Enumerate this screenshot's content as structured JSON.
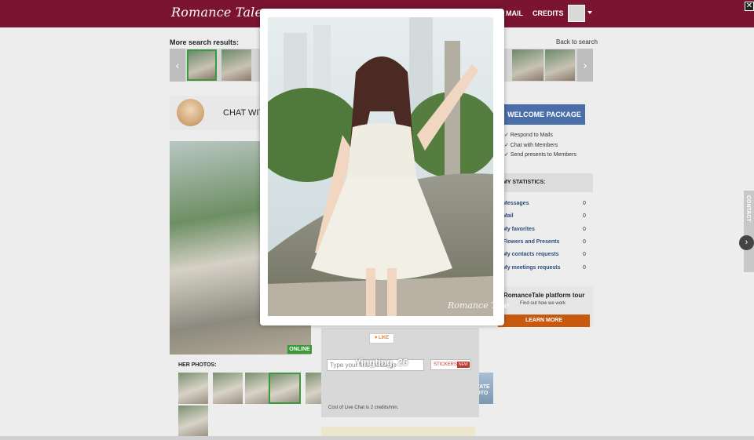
{
  "header": {
    "logo": "Romance Tale",
    "nav": [
      {
        "label": "MAIL"
      },
      {
        "label": "CREDITS"
      }
    ],
    "close": "✕"
  },
  "search": {
    "title": "More search results:",
    "back": "Back to search"
  },
  "profile": {
    "chat_with": "CHAT WIT",
    "online": "ONLINE",
    "her_photos": "HER PHOTOS:",
    "private_photo": "PRIVATE PHOTO"
  },
  "chat": {
    "like": "LIKE",
    "input_placeholder": "Type your first message",
    "stickers": "STICKERS",
    "new": "NEW",
    "cost": "Cost of Live Chat is 2 credits/min.",
    "name_age": "Yingting, 26"
  },
  "sidebar": {
    "welcome": "WELCOME PACKAGE",
    "benefits": [
      "✓ Respond to Mails",
      "✓ Chat with Members",
      "✓ Send presents to Members"
    ],
    "stats_title": "MY STATISTICS:",
    "stats": [
      {
        "label": "Messages",
        "value": "0"
      },
      {
        "label": "Mail",
        "value": "0"
      },
      {
        "label": "My favorites",
        "value": "0"
      },
      {
        "label": "Flowers and Presents",
        "value": "0"
      },
      {
        "label": "My contacts requests",
        "value": "0"
      },
      {
        "label": "My meetings requests",
        "value": "0"
      }
    ],
    "tour_title": "RomanceTale platform tour",
    "tour_sub": "Find out how we work",
    "learn_more": "LEARN MORE",
    "contact": "CONTACT"
  },
  "lightbox": {
    "watermark": "Romance Tale"
  },
  "colors": {
    "header": "#7a1430",
    "online": "#3a9a3a",
    "welcome": "#4a6ea8",
    "learn_more": "#c85a10"
  }
}
